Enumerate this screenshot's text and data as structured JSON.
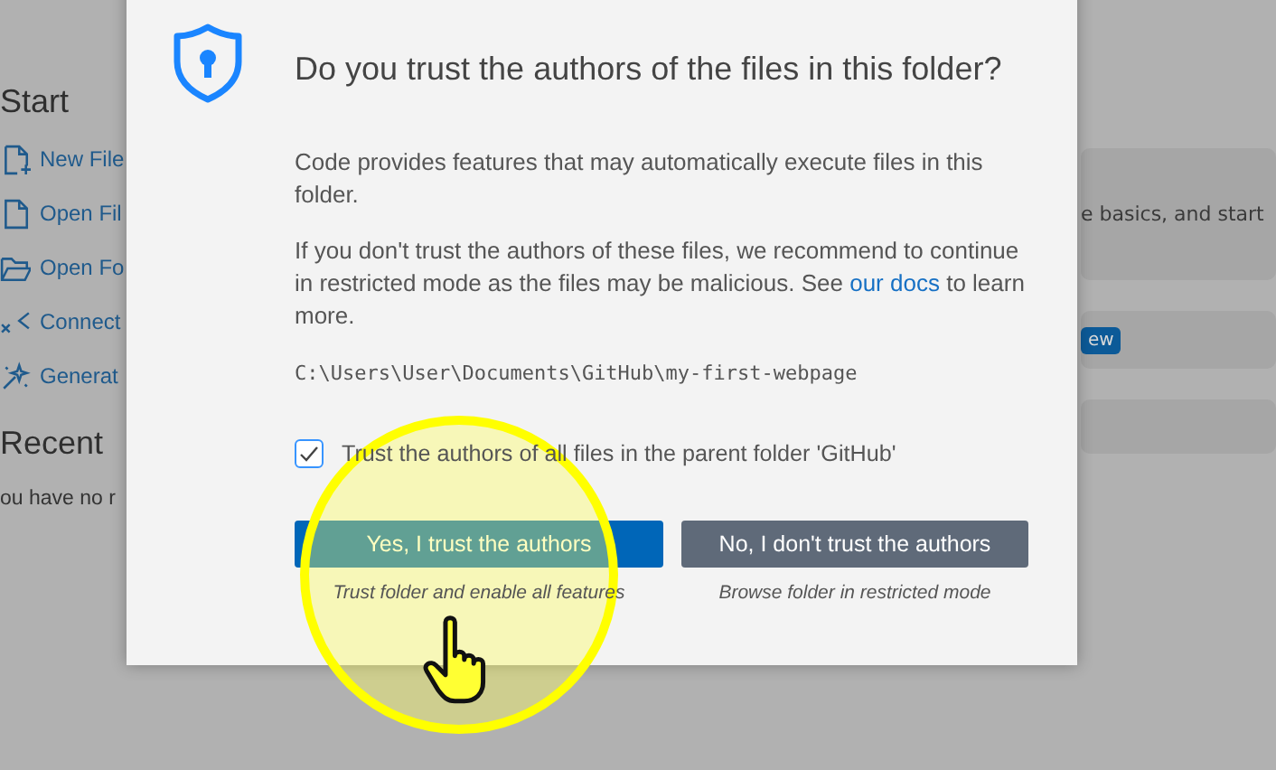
{
  "start": {
    "heading": "Start",
    "items": [
      {
        "kind": "new-file",
        "label": "New File"
      },
      {
        "kind": "open-file",
        "label": "Open Fil"
      },
      {
        "kind": "open-folder",
        "label": "Open Fo"
      },
      {
        "kind": "connect",
        "label": "Connect"
      },
      {
        "kind": "generate",
        "label": "Generat"
      }
    ]
  },
  "recent": {
    "heading": "Recent",
    "text": "ou have no r"
  },
  "walkthroughs": [
    {
      "kind": "text",
      "text": "e basics, and start"
    },
    {
      "kind": "badge",
      "badge": "ew"
    },
    {
      "kind": "blank"
    }
  ],
  "dialog": {
    "title": "Do you trust the authors of the files in this folder?",
    "paragraph_1": "Code provides features that may automatically execute files in this folder.",
    "paragraph_2": {
      "before": "If you don't trust the authors of these files, we recommend to continue in restricted mode as the files may be malicious. See ",
      "link": "our docs",
      "after": " to learn more."
    },
    "path": "C:\\Users\\User\\Documents\\GitHub\\my-first-webpage",
    "checkbox": {
      "label": "Trust the authors of all files in the parent folder 'GitHub'",
      "checked": true
    },
    "buttons": [
      {
        "kind": "primary",
        "label": "Yes, I trust the authors",
        "caption": "Trust folder and enable all features"
      },
      {
        "kind": "secondary",
        "label": "No, I don't trust the authors",
        "caption": "Browse folder in restricted mode"
      }
    ]
  }
}
